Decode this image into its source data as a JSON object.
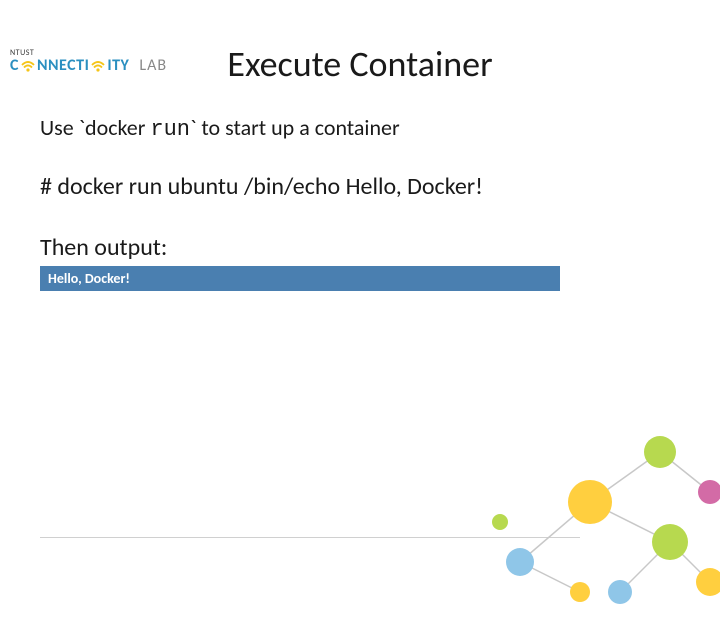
{
  "header": {
    "ntust": "NTUST",
    "logo_part1": "C",
    "logo_part2": "NNECTI",
    "logo_part3": "ITY",
    "lab": "LAB"
  },
  "title": "Execute Container",
  "content": {
    "use_prefix": "Use `docker ",
    "run_literal": "run",
    "use_suffix": "` to start up a container",
    "command": "# docker run ubuntu /bin/echo Hello, Docker!",
    "then": "Then output:",
    "output": "Hello, Docker!"
  },
  "colors": {
    "accent_blue": "#4a7fb0",
    "logo_blue": "#2a8fc0",
    "wifi_yellow": "#f5c518"
  }
}
